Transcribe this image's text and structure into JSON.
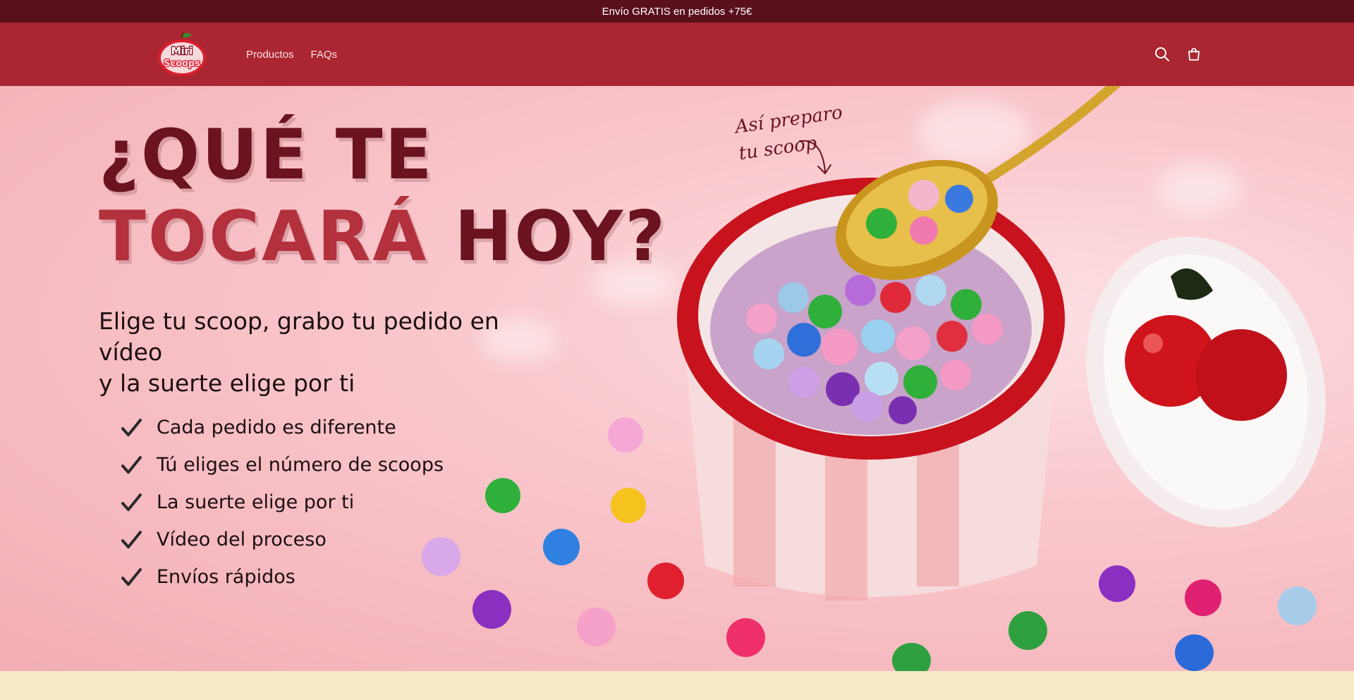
{
  "announcement": {
    "text": "Envío GRATIS en pedidos +75€"
  },
  "header": {
    "logo": {
      "line1": "Miri",
      "line2": "Scoops"
    },
    "nav": [
      {
        "label": "Productos"
      },
      {
        "label": "FAQs"
      }
    ],
    "icons": {
      "search": "search-icon",
      "cart": "cart-icon"
    }
  },
  "hero": {
    "headline": {
      "line1": "¿QUÉ TE",
      "line2_red": "TOCARÁ",
      "line2_dark": "HOY?"
    },
    "subheadline": {
      "line1": "Elige tu scoop, grabo tu pedido en vídeo",
      "line2": "y la suerte elige por ti"
    },
    "features": [
      "Cada pedido es diferente",
      "Tú eliges el número de scoops",
      "La suerte elige por ti",
      "Vídeo del proceso",
      "Envíos rápidos"
    ],
    "handwritten_note": {
      "line1": "Así preparo",
      "line2": "tu scoop"
    }
  },
  "colors": {
    "announcement_bg": "#5a0f1c",
    "header_bg": "#ab2632",
    "headline_dark": "#6b1320",
    "headline_red": "#b3313c",
    "hero_bg": "#f9c7cc",
    "footer_bg": "#f5ecc6"
  }
}
